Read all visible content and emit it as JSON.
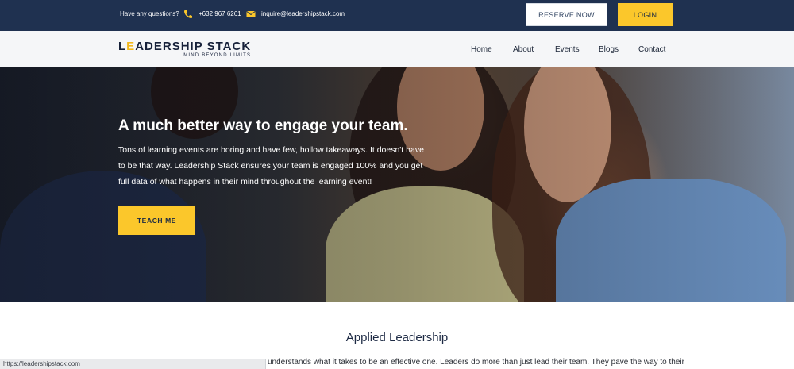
{
  "topbar": {
    "question": "Have any questions?",
    "phone": "+632 967 6261",
    "email": "inquire@leadershipstack.com",
    "reserve_label": "RESERVE NOW",
    "login_label": "LOGIN"
  },
  "logo": {
    "main": "LEADERSHIP STACK",
    "tagline": "MIND BEYOND LIMITS"
  },
  "nav": {
    "items": [
      {
        "label": "Home"
      },
      {
        "label": "About"
      },
      {
        "label": "Events"
      },
      {
        "label": "Blogs"
      },
      {
        "label": "Contact"
      }
    ]
  },
  "hero": {
    "title": "A much better way to engage your team.",
    "body": "Tons of learning events are boring and have few, hollow takeaways. It doesn't have to be that way. Leadership Stack ensures your team is engaged 100% and you get full data of what happens in their mind throughout the learning event!",
    "cta_label": "TEACH ME"
  },
  "section": {
    "title": "Applied Leadership",
    "body_visible": "understands what it takes to be an effective one. Leaders do more than just lead their team. They pave the way to their"
  },
  "status_bar": {
    "url": "https://leadershipstack.com"
  },
  "colors": {
    "topbar_bg": "#1f3150",
    "accent_yellow": "#fbc72b",
    "nav_bg": "#f5f6f8"
  }
}
